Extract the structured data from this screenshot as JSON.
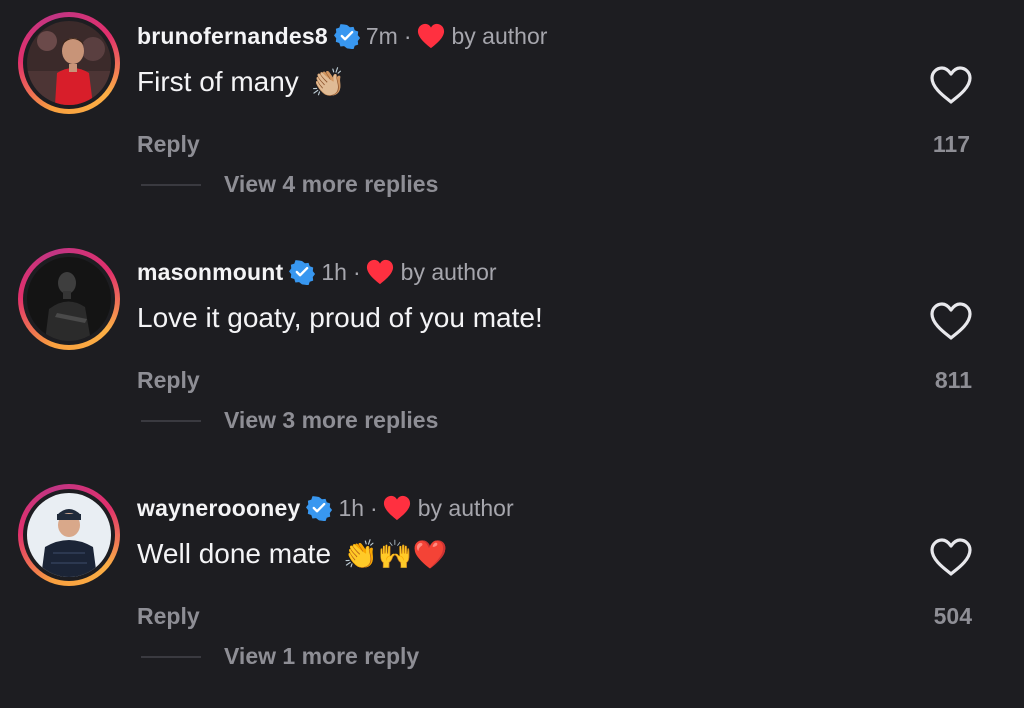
{
  "comments": [
    {
      "username": "brunofernandes8",
      "time": "7m",
      "separator": "·",
      "by_author": "by author",
      "text": "First of many",
      "emojis": "👏🏼",
      "reply_label": "Reply",
      "likes": "117",
      "view_replies": "View 4 more replies"
    },
    {
      "username": "masonmount",
      "time": "1h",
      "separator": "·",
      "by_author": "by author",
      "text": "Love it goaty, proud of you mate!",
      "emojis": "",
      "reply_label": "Reply",
      "likes": "811",
      "view_replies": "View 3 more replies"
    },
    {
      "username": "wayneroooney",
      "time": "1h",
      "separator": "·",
      "by_author": "by author",
      "text": "Well done mate",
      "emojis": "👏🙌❤️",
      "reply_label": "Reply",
      "likes": "504",
      "view_replies": "View 1 more reply"
    }
  ],
  "colors": {
    "background": "#1d1d21",
    "verified": "#3897f0",
    "heart": "#ff3040",
    "muted": "#8e8e95"
  },
  "icons": {
    "verified": "verified-badge-icon",
    "author_like": "heart-filled-icon",
    "like": "heart-outline-icon"
  }
}
